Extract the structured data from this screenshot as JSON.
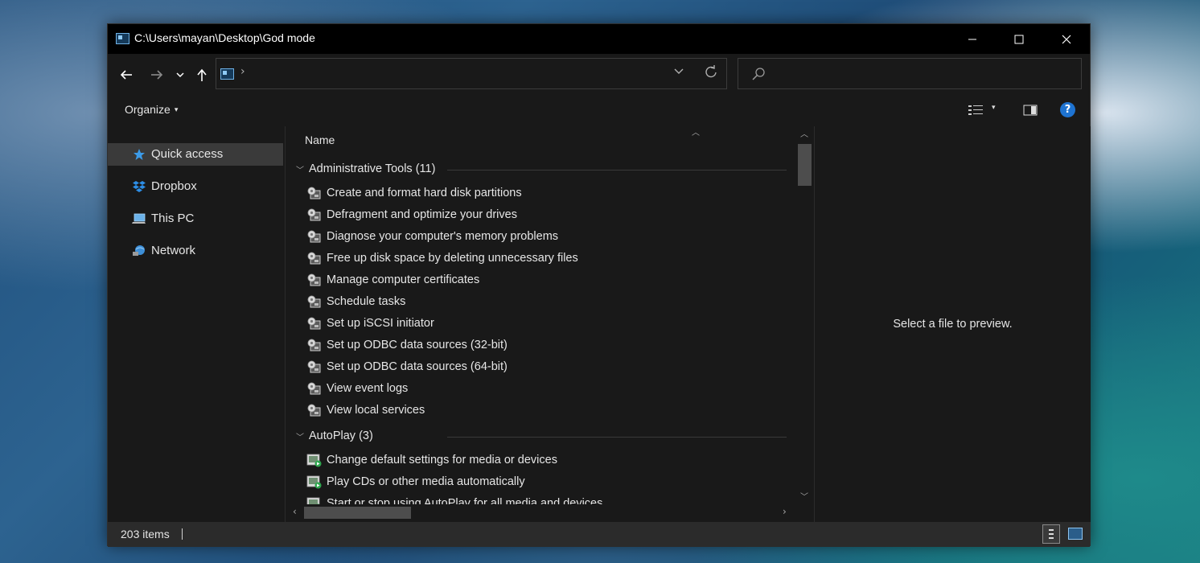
{
  "window": {
    "title": "C:\\Users\\mayan\\Desktop\\God mode",
    "controls": {
      "minimize": "minimize-icon",
      "maximize": "maximize-icon",
      "close": "close-icon"
    }
  },
  "navigation": {
    "back_icon": "back-arrow-icon",
    "forward_icon": "forward-arrow-icon",
    "recent_icon": "chevron-down-icon",
    "up_icon": "up-arrow-icon",
    "address_separator": "›",
    "address_icon": "god-mode-folder-icon",
    "search_placeholder": ""
  },
  "command_bar": {
    "organize_label": "Organize",
    "organize_caret": "▾",
    "view_caret": "▾",
    "help_label": "?"
  },
  "nav_pane": {
    "items": [
      {
        "label": "Quick access",
        "icon": "star-icon",
        "selected": true
      },
      {
        "label": "Dropbox",
        "icon": "dropbox-icon",
        "selected": false
      },
      {
        "label": "This PC",
        "icon": "computer-icon",
        "selected": false
      },
      {
        "label": "Network",
        "icon": "network-icon",
        "selected": false
      }
    ]
  },
  "content": {
    "column_header": "Name",
    "groups": [
      {
        "title": "Administrative Tools (11)",
        "icon": "admin-tools-icon",
        "items": [
          "Create and format hard disk partitions",
          "Defragment and optimize your drives",
          "Diagnose your computer's memory problems",
          "Free up disk space by deleting unnecessary files",
          "Manage computer certificates",
          "Schedule tasks",
          "Set up iSCSI initiator",
          "Set up ODBC data sources (32-bit)",
          "Set up ODBC data sources (64-bit)",
          "View event logs",
          "View local services"
        ]
      },
      {
        "title": "AutoPlay (3)",
        "icon": "autoplay-icon",
        "items": [
          "Change default settings for media or devices",
          "Play CDs or other media automatically",
          "Start or stop using AutoPlay for all media and devices"
        ]
      }
    ]
  },
  "preview": {
    "text": "Select a file to preview."
  },
  "status_bar": {
    "item_count": "203 items"
  },
  "colors": {
    "accent": "#1e73d1",
    "background": "#191919",
    "titlebar": "#000000",
    "statusbar": "#2b2b2b"
  }
}
